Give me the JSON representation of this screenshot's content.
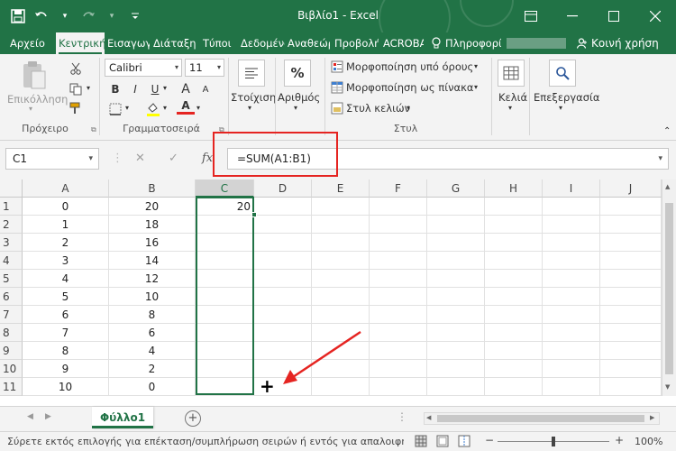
{
  "window": {
    "title": "Βιβλίο1 - Excel",
    "minimize": "—",
    "restore": "☐",
    "close": "✕",
    "ribbon_display": "▭"
  },
  "quick_access": {
    "save": "💾",
    "undo": "↶",
    "redo": "↷",
    "customize": "▾"
  },
  "tabs": [
    {
      "label": "Αρχείο",
      "active": false
    },
    {
      "label": "Κεντρική",
      "active": true
    },
    {
      "label": "Εισαγωγή",
      "active": false
    },
    {
      "label": "Διάταξη",
      "active": false
    },
    {
      "label": "Τύποι",
      "active": false
    },
    {
      "label": "Δεδομένα",
      "active": false
    },
    {
      "label": "Αναθεώρηση",
      "active": false
    },
    {
      "label": "Προβολή",
      "active": false
    },
    {
      "label": "ACROBAT",
      "active": false
    }
  ],
  "tell_me": {
    "label": "Πληροφορίες"
  },
  "share": {
    "label": "Κοινή χρήση"
  },
  "ribbon": {
    "clipboard": {
      "paste": "Επικόλληση",
      "group": "Πρόχειρο"
    },
    "font": {
      "name": "Calibri",
      "size": "11",
      "group": "Γραμματοσειρά",
      "bold": "B",
      "italic": "I",
      "underline": "U",
      "grow": "A",
      "shrink": "A",
      "font_color": "A"
    },
    "alignment": {
      "label": "Στοίχιση"
    },
    "number": {
      "label": "Αριθμός",
      "symbol": "%"
    },
    "styles": {
      "conditional": "Μορφοποίηση υπό όρους",
      "as_table": "Μορφοποίηση ως πίνακα",
      "cell_styles": "Στυλ κελιών",
      "group": "Στυλ"
    },
    "cells": {
      "label": "Κελιά"
    },
    "editing": {
      "label": "Επεξεργασία"
    },
    "caret": "▾"
  },
  "formula_bar": {
    "name_box": "C1",
    "cancel": "✕",
    "enter": "✓",
    "fx": "fx",
    "formula": "=SUM(A1:B1)"
  },
  "grid": {
    "columns": [
      "A",
      "B",
      "C",
      "D",
      "E",
      "F",
      "G",
      "H",
      "I",
      "J"
    ],
    "selected_column": "C",
    "rows": [
      {
        "n": "1",
        "a": "0",
        "b": "20",
        "c": "20"
      },
      {
        "n": "2",
        "a": "1",
        "b": "18",
        "c": ""
      },
      {
        "n": "3",
        "a": "2",
        "b": "16",
        "c": ""
      },
      {
        "n": "4",
        "a": "3",
        "b": "14",
        "c": ""
      },
      {
        "n": "5",
        "a": "4",
        "b": "12",
        "c": ""
      },
      {
        "n": "6",
        "a": "5",
        "b": "10",
        "c": ""
      },
      {
        "n": "7",
        "a": "6",
        "b": "8",
        "c": ""
      },
      {
        "n": "8",
        "a": "7",
        "b": "6",
        "c": ""
      },
      {
        "n": "9",
        "a": "8",
        "b": "4",
        "c": ""
      },
      {
        "n": "10",
        "a": "9",
        "b": "2",
        "c": ""
      },
      {
        "n": "11",
        "a": "10",
        "b": "0",
        "c": ""
      }
    ]
  },
  "cursor": "+",
  "sheets": [
    {
      "label": "Φύλλο1",
      "active": true
    }
  ],
  "sheet_nav": {
    "prev": "◀",
    "next": "▶",
    "add": "+"
  },
  "status": {
    "text": "Σύρετε εκτός επιλογής για επέκταση/συμπλήρωση σειρών ή εντός για απαλοιφή",
    "zoom": "100%",
    "zoom_minus": "−",
    "zoom_plus": "+"
  },
  "colors": {
    "excel_green": "#217346",
    "annotation_red": "#e52421"
  }
}
